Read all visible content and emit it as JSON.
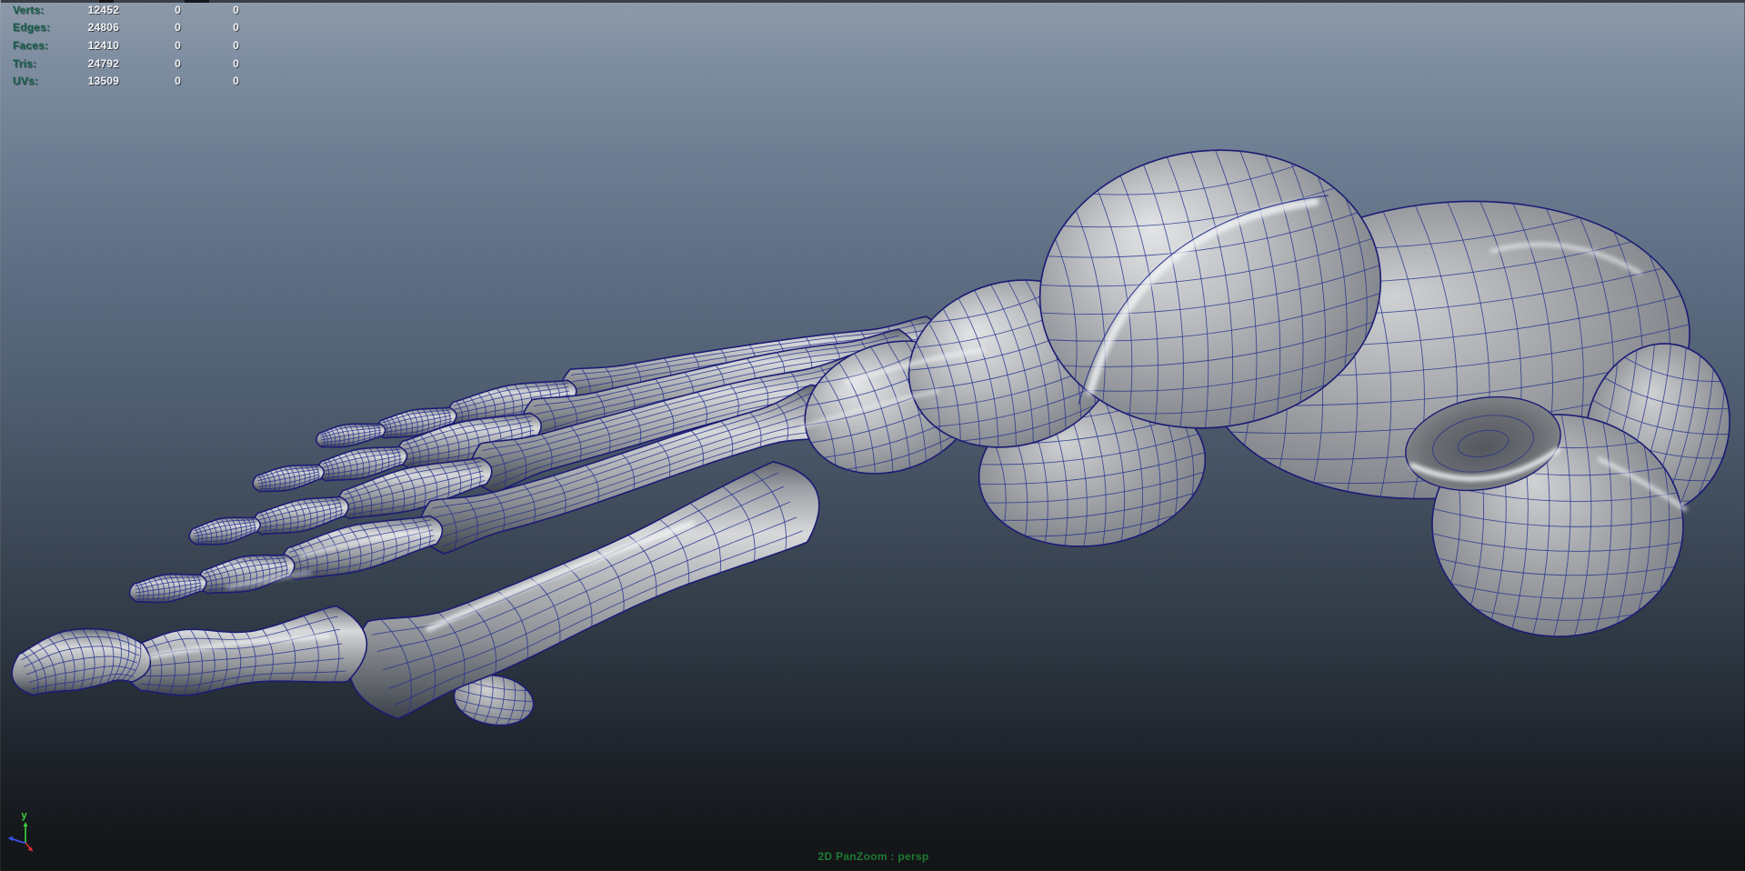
{
  "hud": {
    "label_color": "#155f49",
    "value_color": "#f2f4f5",
    "rows": [
      {
        "label": "Verts:",
        "values": [
          "12452",
          "0",
          "0"
        ]
      },
      {
        "label": "Edges:",
        "values": [
          "24806",
          "0",
          "0"
        ]
      },
      {
        "label": "Faces:",
        "values": [
          "12410",
          "0",
          "0"
        ]
      },
      {
        "label": "Tris:",
        "values": [
          "24792",
          "0",
          "0"
        ]
      },
      {
        "label": "UVs:",
        "values": [
          "13509",
          "0",
          "0"
        ]
      }
    ]
  },
  "viewport": {
    "camera_label": "2D PanZoom : persp",
    "camera_label_color": "#1f7a33",
    "background_top": "#8e9aa9",
    "background_bottom": "#121416",
    "model_description": "smoothed polygon foot-skeleton mesh, wireframe on shaded",
    "wireframe_color": "#232e8c",
    "edge_color": "#1b1b74",
    "axis_gizmo": {
      "y_label": "y",
      "x_color": "#d83030",
      "y_color": "#3fd23f",
      "z_color": "#3a50e0"
    }
  }
}
